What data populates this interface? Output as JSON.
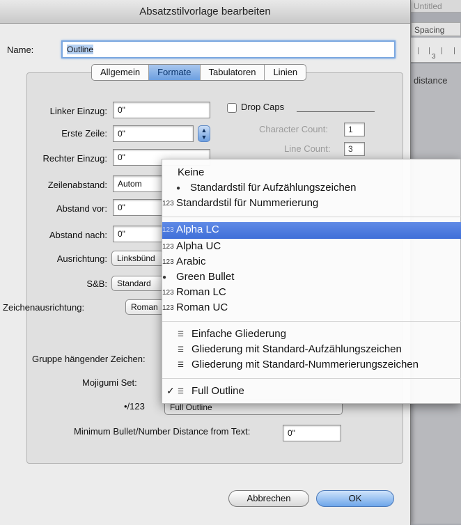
{
  "window": {
    "title": "Absatzstilvorlage bearbeiten"
  },
  "background_app": {
    "tab": "Untitled",
    "spacing": "Spacing",
    "ruler_mark": "3",
    "distance": "distance"
  },
  "name": {
    "label": "Name:",
    "value": "Outline"
  },
  "tabs": [
    "Allgemein",
    "Formate",
    "Tabulatoren",
    "Linien"
  ],
  "fields": {
    "linker_einzug": {
      "label": "Linker Einzug:",
      "value": "0\""
    },
    "erste_zeile": {
      "label": "Erste Zeile:",
      "value": "0\""
    },
    "rechter_einzug": {
      "label": "Rechter Einzug:",
      "value": "0\""
    },
    "zeilenabstand": {
      "label": "Zeilenabstand:",
      "value": "Autom"
    },
    "abstand_vor": {
      "label": "Abstand vor:",
      "value": "0\""
    },
    "abstand_nach": {
      "label": "Abstand nach:",
      "value": "0\""
    },
    "ausrichtung": {
      "label": "Ausrichtung:",
      "value": "Linksbünd"
    },
    "sb": {
      "label": "S&B:",
      "value": "Standard"
    },
    "zeichenausrichtung": {
      "label": "Zeichenausrichtung:",
      "value": "Roman"
    },
    "gruppe": {
      "label": "Gruppe hängender Zeichen:"
    },
    "mojigumi": {
      "label": "Mojigumi Set:"
    },
    "bullet_number": {
      "label": "•/123",
      "value": "Full Outline"
    },
    "min_distance": {
      "label": "Minimum Bullet/Number Distance from Text:",
      "value": "0\""
    }
  },
  "drop_caps": {
    "label": "Drop Caps",
    "character_count_label": "Character Count:",
    "character_count": "1",
    "line_count_label": "Line Count:",
    "line_count": "3"
  },
  "buttons": {
    "cancel": "Abbrechen",
    "ok": "OK"
  },
  "menu": {
    "group1": [
      {
        "icon": "",
        "label": "Keine"
      },
      {
        "icon": "●",
        "label": "Standardstil für Aufzählungszeichen"
      },
      {
        "icon": "123",
        "label": "Standardstil für Nummerierung"
      }
    ],
    "group2": [
      {
        "icon": "123",
        "label": "Alpha LC"
      },
      {
        "icon": "123",
        "label": "Alpha UC"
      },
      {
        "icon": "123",
        "label": "Arabic"
      },
      {
        "icon": "●",
        "label": "Green Bullet"
      },
      {
        "icon": "123",
        "label": "Roman LC"
      },
      {
        "icon": "123",
        "label": "Roman UC"
      }
    ],
    "group3": [
      {
        "icon": "☰",
        "label": "Einfache Gliederung"
      },
      {
        "icon": "☰",
        "label": "Gliederung mit Standard-Aufzählungszeichen"
      },
      {
        "icon": "☰",
        "label": "Gliederung mit Standard-Nummerierungszeichen"
      }
    ],
    "selected": {
      "check": "✓",
      "icon": "☰",
      "label": "Full Outline"
    }
  }
}
